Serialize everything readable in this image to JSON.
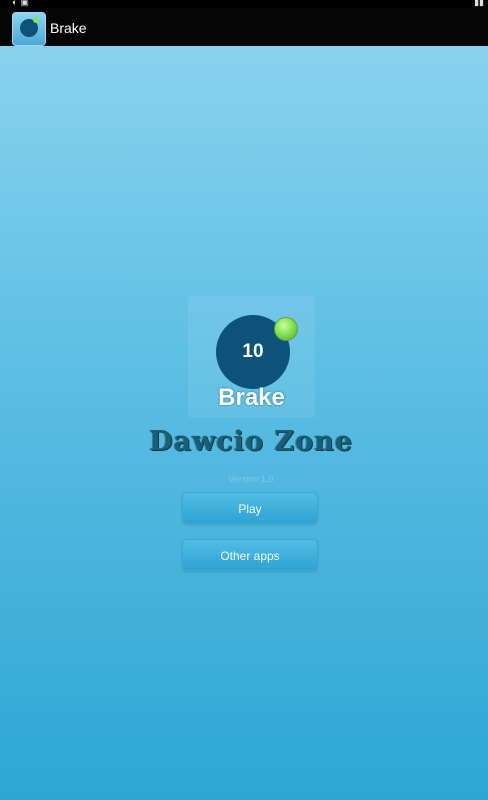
{
  "app": {
    "title": "Brake",
    "icon_name": "brake-app-icon",
    "icon_label": "10"
  },
  "logo": {
    "number": "10",
    "label": "Brake"
  },
  "developer": {
    "name": "Dawcio Zone"
  },
  "version": {
    "text": "Version 1.0"
  },
  "buttons": {
    "play_label": "Play",
    "other_apps_label": "Other apps"
  },
  "colors": {
    "background_top": "#88d2ef",
    "background_bottom": "#2da6d6",
    "logo_disc": "#0d5279",
    "ball_green": "#79d84c",
    "button_blue": "#3aa8d8"
  }
}
